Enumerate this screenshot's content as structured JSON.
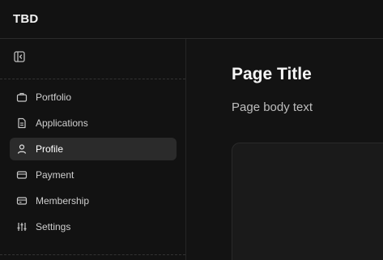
{
  "header": {
    "brand": "TBD"
  },
  "sidebar": {
    "collapse_icon": "sidebar-collapse-icon",
    "items": [
      {
        "label": "Portfolio",
        "icon": "briefcase-icon",
        "active": false
      },
      {
        "label": "Applications",
        "icon": "document-icon",
        "active": false
      },
      {
        "label": "Profile",
        "icon": "user-icon",
        "active": true
      },
      {
        "label": "Payment",
        "icon": "card-icon",
        "active": false
      },
      {
        "label": "Membership",
        "icon": "membership-card-icon",
        "active": false
      },
      {
        "label": "Settings",
        "icon": "sliders-icon",
        "active": false
      }
    ]
  },
  "main": {
    "title": "Page Title",
    "body": "Page body text"
  },
  "colors": {
    "background": "#111111",
    "active_item": "#2b2b2b",
    "text": "#e8e8e8"
  }
}
